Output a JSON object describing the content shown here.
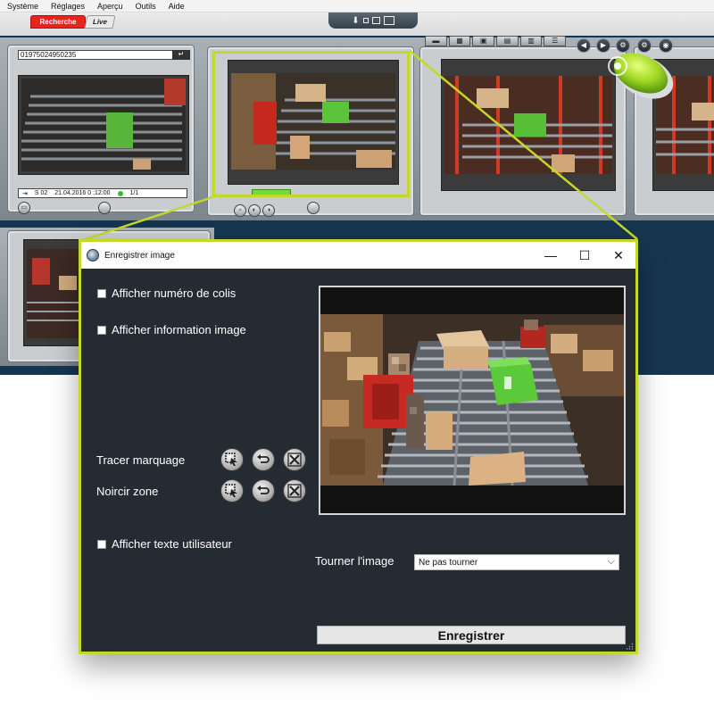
{
  "menubar": {
    "items": [
      "Système",
      "Réglages",
      "Aperçu",
      "Outils",
      "Aide"
    ]
  },
  "mode_tabs": {
    "search": "Recherche",
    "live": "Live"
  },
  "camera_panel": {
    "parcel_number": "01975024950235",
    "station": "S 02",
    "timestamp": "21.04.2016 0 :12:00",
    "page": "1/1"
  },
  "dialog": {
    "title": "Enregistrer image",
    "show_parcel_number": "Afficher numéro de colis",
    "show_image_info": "Afficher information image",
    "draw_marking": "Tracer marquage",
    "blacken_zone": "Noircir zone",
    "show_user_text": "Afficher texte utilisateur",
    "rotate_label": "Tourner l'image",
    "rotate_value": "Ne pas tourner",
    "save_button": "Enregistrer"
  },
  "colors": {
    "accent_callout": "#c4d82a",
    "dialog_bg": "#252b33",
    "workspace_bg": "#163650",
    "search_tab": "#e8251c"
  },
  "icons": {
    "minimize": "minimize-icon",
    "maximize": "maximize-icon",
    "close": "close-icon",
    "select_tool": "cursor-select-icon",
    "undo_tool": "undo-icon",
    "delete_tool": "delete-icon"
  }
}
